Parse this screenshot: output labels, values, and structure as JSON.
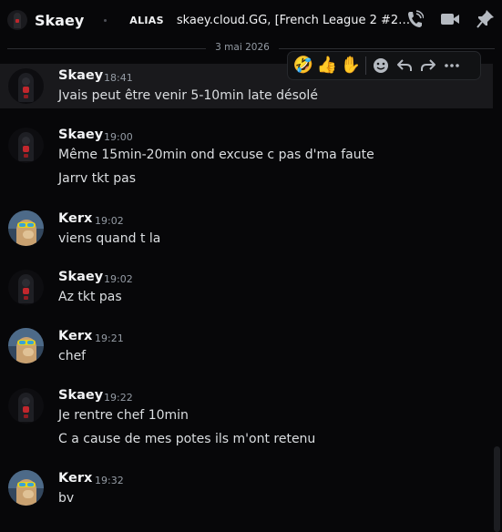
{
  "header": {
    "name": "Skaey",
    "alias_label": "ALIAS",
    "alias_value": "skaey.cloud.GG, [French League 2 #2] SKA..."
  },
  "icons": [
    "call-icon",
    "video-icon",
    "pin-icon"
  ],
  "date_divider": "3 mai 2026",
  "toolbar": {
    "reactions": [
      "🤣",
      "👍",
      "✋"
    ],
    "actions": [
      "add-reaction-icon",
      "reply-icon",
      "forward-icon",
      "more-icon"
    ]
  },
  "messages": [
    {
      "author": "Skaey",
      "time": "18:41",
      "lines": [
        "Jvais peut être venir 5-10min late désolé"
      ]
    },
    {
      "author": "Skaey",
      "time": "19:00",
      "lines": [
        "Même 15min-20min ond excuse c pas d'ma faute",
        "Jarrv tkt pas"
      ]
    },
    {
      "author": "Kerx",
      "time": "19:02",
      "lines": [
        "viens quand t la"
      ]
    },
    {
      "author": "Skaey",
      "time": "19:02",
      "lines": [
        "Az tkt pas"
      ]
    },
    {
      "author": "Kerx",
      "time": "19:21",
      "lines": [
        "chef"
      ]
    },
    {
      "author": "Skaey",
      "time": "19:22",
      "lines": [
        "Je rentre chef 10min",
        "C a cause de mes potes ils m'ont retenu"
      ]
    },
    {
      "author": "Kerx",
      "time": "19:32",
      "lines": [
        "bv"
      ]
    }
  ]
}
